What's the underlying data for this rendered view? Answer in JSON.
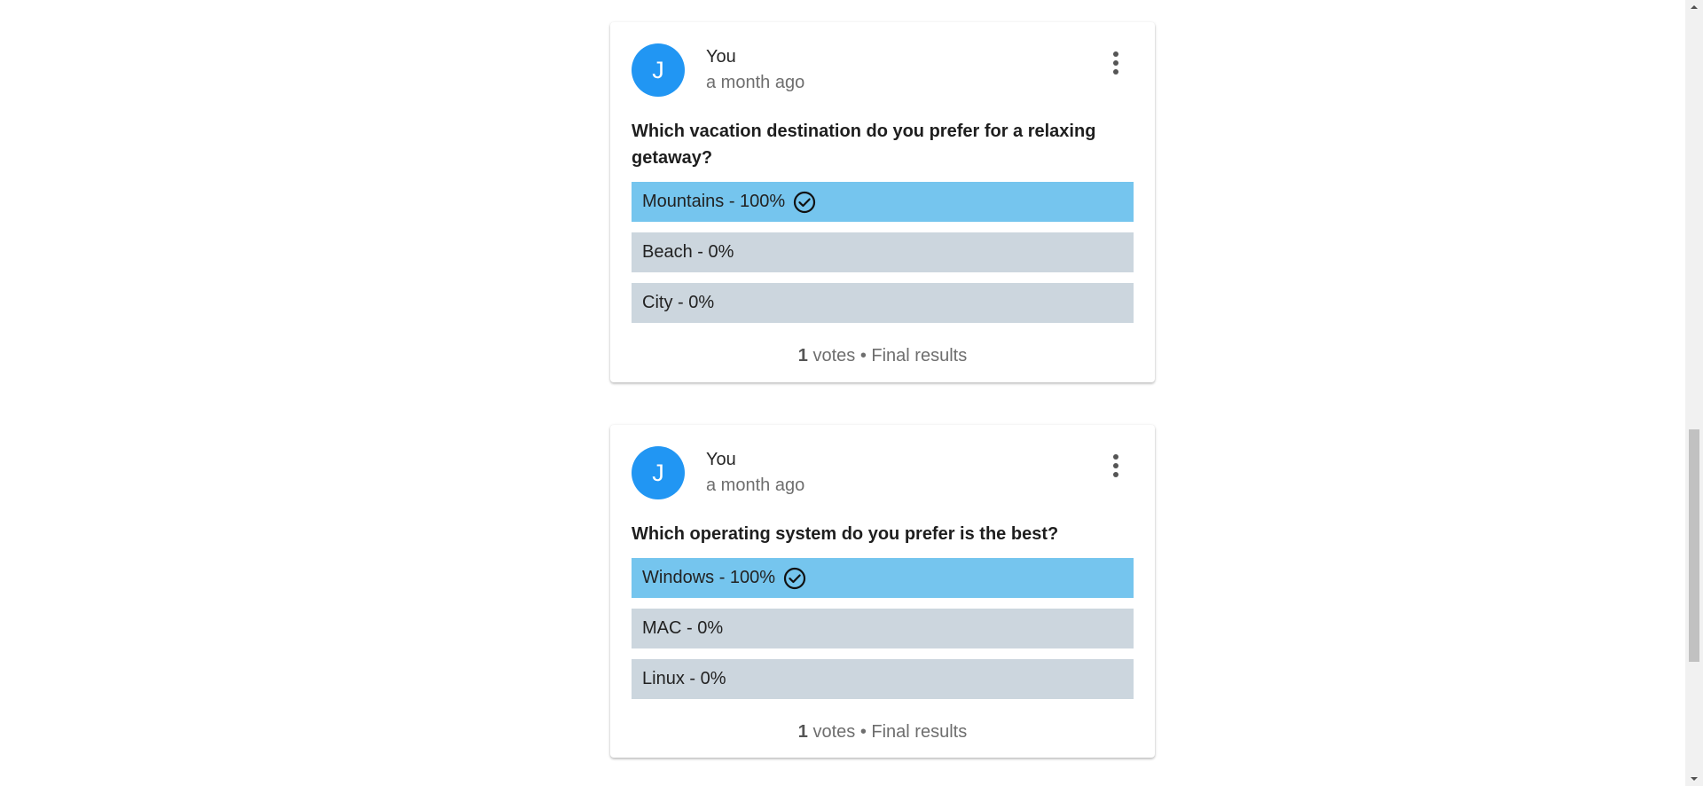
{
  "polls": [
    {
      "author": "You",
      "avatar_initial": "J",
      "time": "a month ago",
      "question": "Which vacation destination do you prefer for a relaxing getaway?",
      "options": [
        {
          "label": "Mountains - 100%",
          "selected": true
        },
        {
          "label": "Beach - 0%",
          "selected": false
        },
        {
          "label": "City - 0%",
          "selected": false
        }
      ],
      "vote_count": "1",
      "votes_suffix": " votes • Final results"
    },
    {
      "author": "You",
      "avatar_initial": "J",
      "time": "a month ago",
      "question": "Which operating system do you prefer is the best?",
      "options": [
        {
          "label": "Windows - 100%",
          "selected": true
        },
        {
          "label": "MAC - 0%",
          "selected": false
        },
        {
          "label": "Linux - 0%",
          "selected": false
        }
      ],
      "vote_count": "1",
      "votes_suffix": " votes • Final results"
    }
  ],
  "colors": {
    "avatar": "#2196f3",
    "option_selected": "#75c5ee",
    "option_default": "#ccd6de"
  },
  "icons": {
    "menu": "more-vert-icon",
    "selected_check": "check-circle-icon"
  }
}
